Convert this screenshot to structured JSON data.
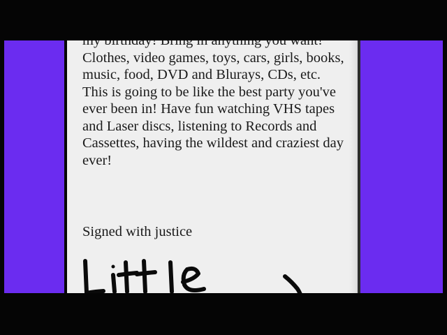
{
  "letter": {
    "body": "my birthday! Bring in anything you want! Clothes, video games, toys, cars, girls, books, music, food, DVD and Blurays, CDs, etc. This is going to be like the best party you've ever been in! Have fun watching VHS tapes and Laser discs, listening to Records and Cassettes, having the wildest and craziest day ever!",
    "signoff": "Signed with justice",
    "signature": "Litt le"
  },
  "colors": {
    "side_panels": "#6b2cf0",
    "paper": "#efefef",
    "background": "#050505"
  }
}
